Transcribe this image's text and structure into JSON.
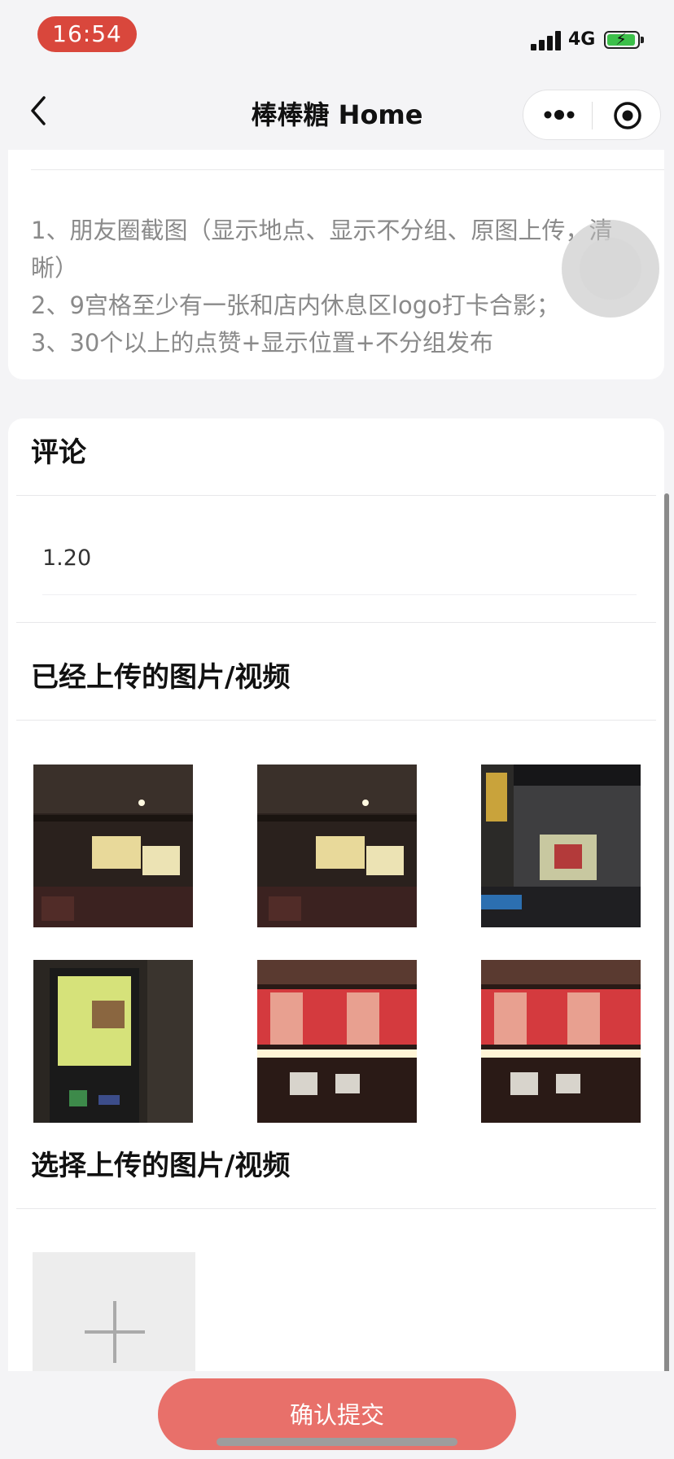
{
  "status_bar": {
    "time": "16:54",
    "network": "4G",
    "battery_icon": "battery-charging-icon"
  },
  "nav": {
    "title": "棒棒糖 Home",
    "back_icon": "chevron-left-icon",
    "more_icon": "more-dots-icon",
    "close_icon": "target-circle-icon"
  },
  "requirements": {
    "lines": [
      "1、朋友圈截图（显示地点、显示不分组、原图上传，清晰）",
      "2、9宫格至少有一张和店内休息区logo打卡合影；",
      "3、30个以上的点赞+显示位置+不分组发布"
    ]
  },
  "comment": {
    "title": "评论",
    "value": "1.20"
  },
  "uploaded": {
    "title": "已经上传的图片/视频",
    "images": [
      {
        "name": "cinema-menu-board-photo-1",
        "theme": "dark"
      },
      {
        "name": "cinema-menu-board-photo-2",
        "theme": "dark"
      },
      {
        "name": "cinema-lobby-screen-photo",
        "theme": "lobby"
      },
      {
        "name": "popcorn-lightbox-poster-photo",
        "theme": "poster"
      },
      {
        "name": "red-ad-banner-photo-1",
        "theme": "red"
      },
      {
        "name": "red-ad-banner-photo-2",
        "theme": "red"
      }
    ]
  },
  "select_upload": {
    "title": "选择上传的图片/视频",
    "add_icon": "plus-icon"
  },
  "footer": {
    "submit_label": "确认提交"
  },
  "colors": {
    "accent": "#e8706a",
    "time_pill": "#d9473c",
    "battery": "#3cc04a"
  }
}
